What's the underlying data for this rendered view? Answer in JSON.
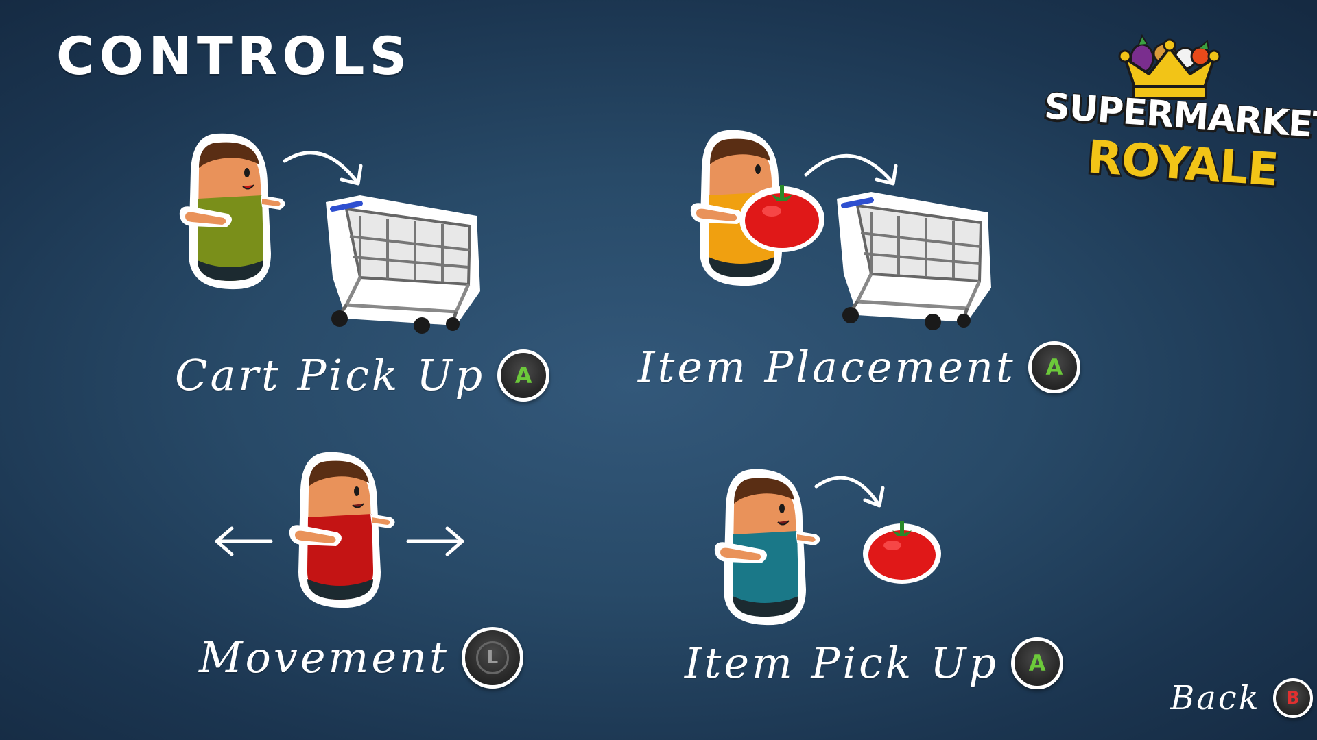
{
  "screen": {
    "title": "CONTROLS",
    "logo": {
      "line1": "SUPERMARKET",
      "line2": "ROYALE"
    },
    "controls": [
      {
        "label": "Cart Pick Up",
        "button": "A",
        "button_color": "#6cc93a"
      },
      {
        "label": "Item Placement",
        "button": "A",
        "button_color": "#6cc93a"
      },
      {
        "label": "Movement",
        "button": "L",
        "button_color": "#9a9a9a"
      },
      {
        "label": "Item Pick Up",
        "button": "A",
        "button_color": "#6cc93a"
      }
    ],
    "back": {
      "label": "Back",
      "button": "B",
      "button_color": "#e03030"
    }
  },
  "colors": {
    "background": "#284a68",
    "shirt_green": "#7a8f1a",
    "shirt_orange": "#f0a010",
    "shirt_red": "#c41414",
    "shirt_teal": "#1a7888",
    "tomato": "#e01818",
    "logo_yellow": "#f2c417"
  },
  "icons": [
    "character-icon",
    "shopping-cart-icon",
    "tomato-icon",
    "arrow-icon",
    "crown-icon"
  ]
}
